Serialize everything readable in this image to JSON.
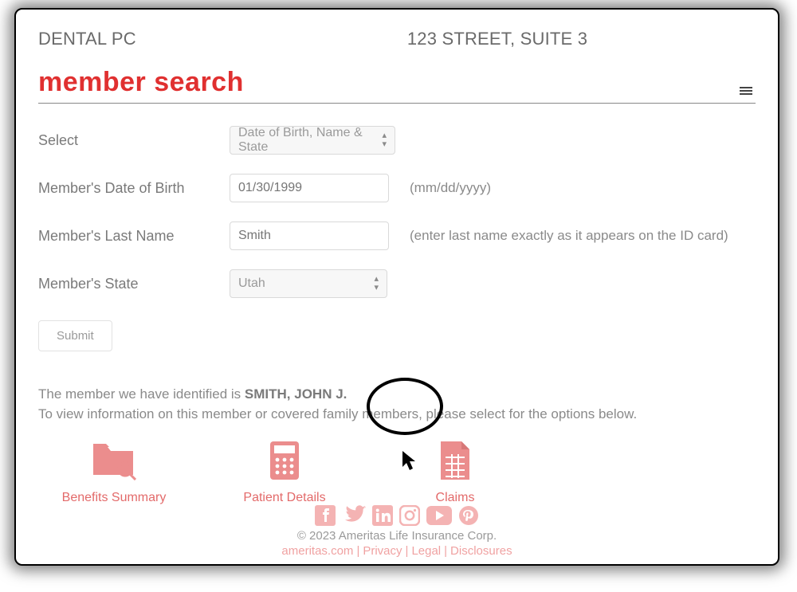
{
  "header": {
    "provider": "DENTAL PC",
    "address": "123 STREET, SUITE 3"
  },
  "page": {
    "title": "member search"
  },
  "form": {
    "select_label": "Select",
    "select_value": "Date of Birth, Name & State",
    "dob_label": "Member's Date of Birth",
    "dob_placeholder": "01/30/1999",
    "dob_hint": "(mm/dd/yyyy)",
    "lastname_label": "Member's Last Name",
    "lastname_placeholder": "Smith",
    "lastname_hint": "(enter last name exactly as it appears on the ID card)",
    "state_label": "Member's State",
    "state_value": "Utah",
    "submit_label": "Submit"
  },
  "result": {
    "prefix": "The member we have identified is ",
    "name": "SMITH, JOHN J.",
    "instruction": "To view information on this member or covered family members, please select for the options below."
  },
  "options": {
    "benefits": "Benefits Summary",
    "patient": "Patient Details",
    "claims": "Claims"
  },
  "footer": {
    "copyright": "© 2023 Ameritas Life Insurance Corp.",
    "links": {
      "site": "ameritas.com",
      "privacy": "Privacy",
      "legal": "Legal",
      "disclosures": "Disclosures"
    }
  }
}
